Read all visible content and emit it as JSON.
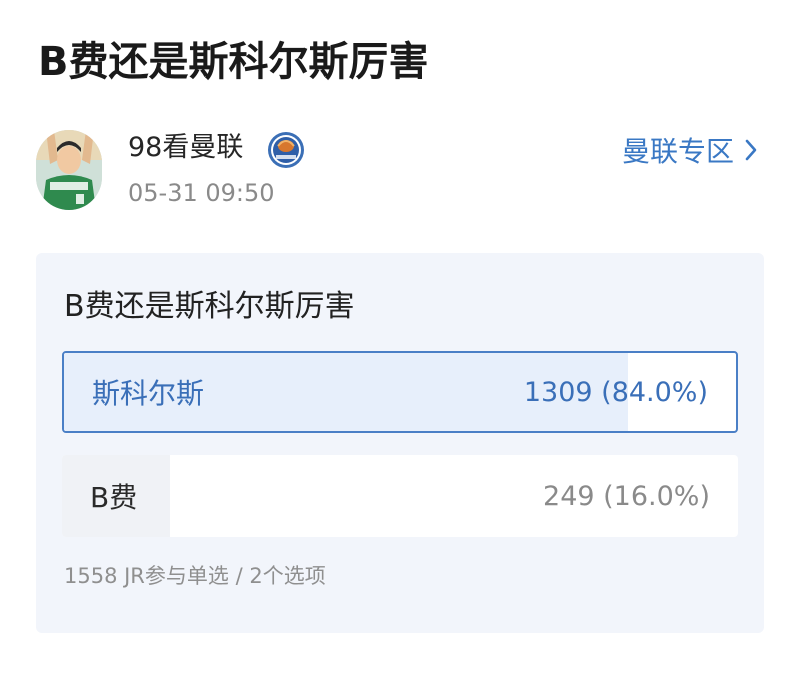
{
  "post": {
    "title": "B费还是斯科尔斯厉害"
  },
  "author": {
    "name": "98看曼联",
    "time": "05-31 09:50",
    "avatar_icon": "avatar-image",
    "badge_icon": "team-badge-icon"
  },
  "zone_link": {
    "label": "曼联专区",
    "icon": "chevron-right-icon"
  },
  "poll": {
    "question": "B费还是斯科尔斯厉害",
    "options": [
      {
        "label": "斯科尔斯",
        "result": "1309 (84.0%)",
        "votes": 1309,
        "fraction": 0.84,
        "selected": true
      },
      {
        "label": "B费",
        "result": "249 (16.0%)",
        "votes": 249,
        "fraction": 0.16,
        "selected": false
      }
    ],
    "footer": "1558 JR参与单选 / 2个选项"
  },
  "colors": {
    "accent": "#3a78c4",
    "card_bg": "#f2f5fb",
    "selected_fill": "#e7effb",
    "muted_text": "#8a8a8a"
  }
}
